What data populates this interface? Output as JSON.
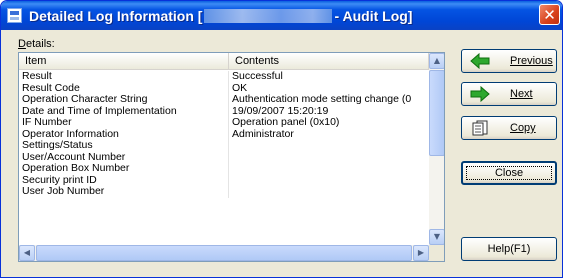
{
  "window": {
    "title_prefix": "Detailed Log Information [",
    "title_suffix": " - Audit Log]",
    "close_symbol": "✕"
  },
  "details": {
    "label_accel": "D",
    "label_rest": "etails:"
  },
  "list": {
    "columns": [
      "Item",
      "Contents"
    ],
    "rows": [
      {
        "item": "Result",
        "contents": "Successful"
      },
      {
        "item": "Result Code",
        "contents": "OK"
      },
      {
        "item": "Operation Character String",
        "contents": "Authentication mode setting change (0"
      },
      {
        "item": "Date and Time of Implementation",
        "contents": "19/09/2007 15:20:19"
      },
      {
        "item": "IF Number",
        "contents": "Operation panel (0x10)"
      },
      {
        "item": "Operator Information",
        "contents": "Administrator"
      },
      {
        "item": "Settings/Status",
        "contents": ""
      },
      {
        "item": "User/Account Number",
        "contents": ""
      },
      {
        "item": "Operation Box Number",
        "contents": ""
      },
      {
        "item": "Security print ID",
        "contents": ""
      },
      {
        "item": "User Job Number",
        "contents": ""
      }
    ]
  },
  "buttons": {
    "previous": "Previous",
    "next": "Next",
    "copy": "Copy",
    "close": "Close",
    "help": "Help(F1)"
  },
  "icons": {
    "previous": "left-arrow-green",
    "next": "right-arrow-green",
    "copy": "document-copy",
    "close_window": "x-mark"
  },
  "colors": {
    "titlebar": "#0054e3",
    "arrow_green": "#2ea82e"
  }
}
